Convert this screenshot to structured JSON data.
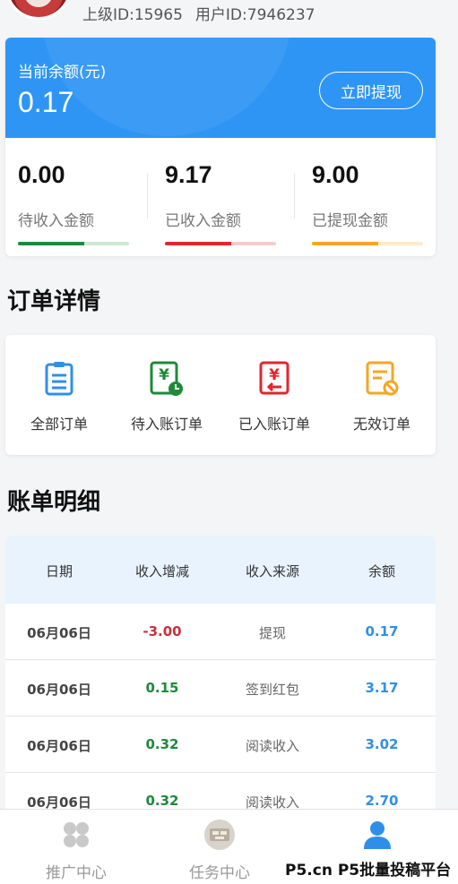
{
  "user": {
    "parent_id_label": "上级ID:15965",
    "user_id_label": "用户ID:7946237"
  },
  "balance": {
    "label": "当前余额(元)",
    "value": "0.17",
    "withdraw_button": "立即提现"
  },
  "stats": [
    {
      "value": "0.00",
      "label": "待收入金额",
      "color": "#1e8a3e",
      "track": "#cfe8d6",
      "progress": 0.6
    },
    {
      "value": "9.17",
      "label": "已收入金额",
      "color": "#e0262e",
      "track": "#f6cccc",
      "progress": 0.6
    },
    {
      "value": "9.00",
      "label": "已提现金额",
      "color": "#f5a623",
      "track": "#fbeacb",
      "progress": 0.6
    }
  ],
  "orders": {
    "title": "订单详情",
    "items": [
      {
        "label": "全部订单",
        "icon": "order-list-icon",
        "color": "#2f8fe8"
      },
      {
        "label": "待入账订单",
        "icon": "pending-yuan-icon",
        "color": "#1d8a3a"
      },
      {
        "label": "已入账订单",
        "icon": "received-yuan-icon",
        "color": "#e0262e"
      },
      {
        "label": "无效订单",
        "icon": "invalid-order-icon",
        "color": "#f5a623"
      }
    ]
  },
  "ledger": {
    "title": "账单明细",
    "headers": [
      "日期",
      "收入增减",
      "收入来源",
      "余额"
    ],
    "rows": [
      {
        "date": "06月06日",
        "change": "-3.00",
        "source": "提现",
        "balance": "0.17"
      },
      {
        "date": "06月06日",
        "change": "0.15",
        "source": "签到红包",
        "balance": "3.17"
      },
      {
        "date": "06月06日",
        "change": "0.32",
        "source": "阅读收入",
        "balance": "3.02"
      },
      {
        "date": "06月06日",
        "change": "0.32",
        "source": "阅读收入",
        "balance": "2.70"
      }
    ]
  },
  "bottom_nav": [
    {
      "label": "推广中心",
      "icon": "clover-icon"
    },
    {
      "label": "任务中心",
      "icon": "task-icon"
    },
    {
      "label": "",
      "icon": "user-icon",
      "active": true
    }
  ],
  "watermark": "P5.cn P5批量投稿平台"
}
